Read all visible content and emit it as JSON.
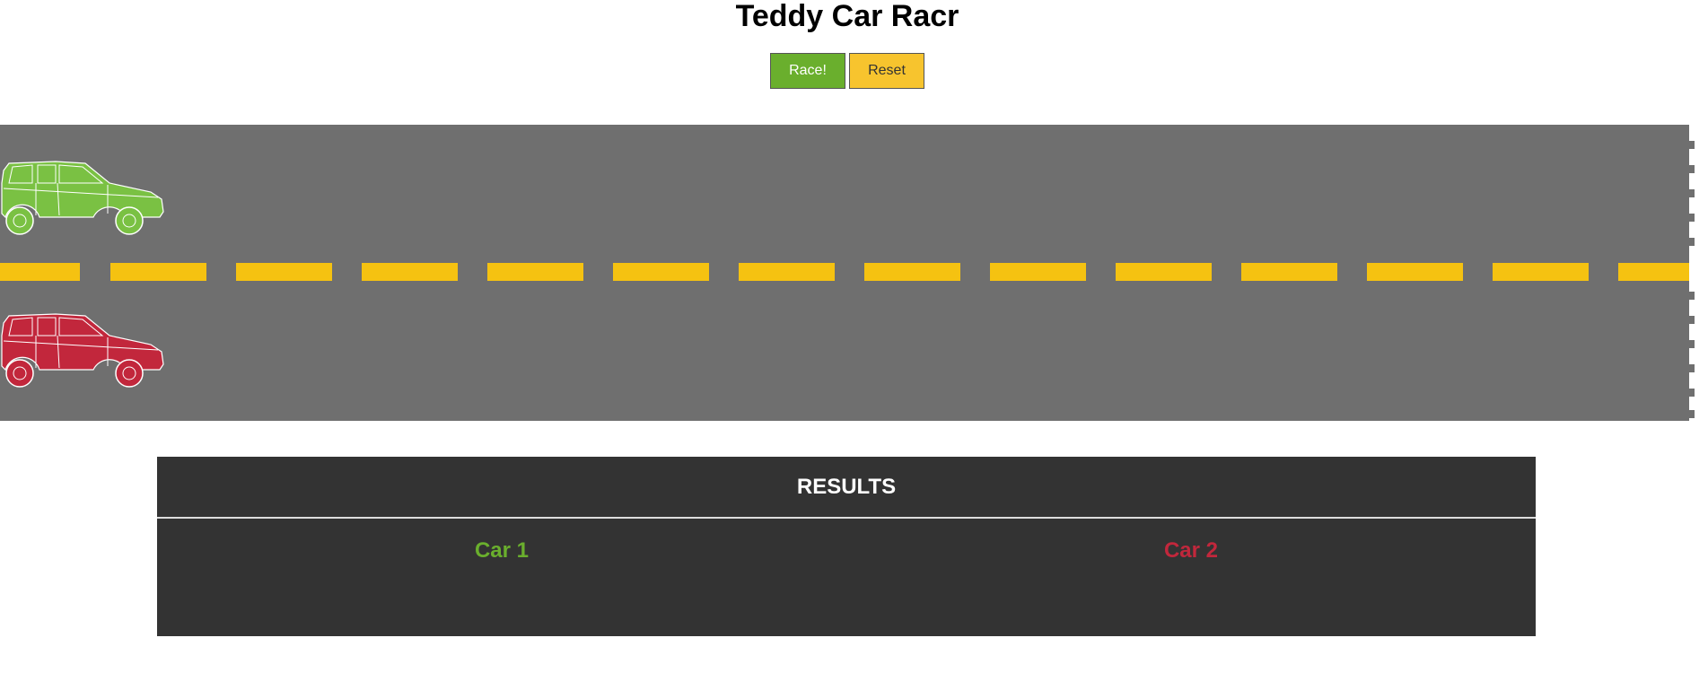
{
  "title": "Teddy Car Racr",
  "controls": {
    "race_label": "Race!",
    "reset_label": "Reset"
  },
  "colors": {
    "race_button": "#6aaf2d",
    "reset_button": "#f7c42e",
    "track": "#6f6f6f",
    "lane_stripe": "#f5c211",
    "car_1": "#7ac143",
    "car_2": "#c2273c",
    "results_bg": "#333333"
  },
  "track": {
    "cars": [
      {
        "name": "Car 1",
        "color": "#7ac143",
        "icon": "car-icon"
      },
      {
        "name": "Car 2",
        "color": "#c2273c",
        "icon": "car-icon"
      }
    ]
  },
  "results": {
    "heading": "RESULTS",
    "columns": [
      "Car 1",
      "Car 2"
    ]
  }
}
